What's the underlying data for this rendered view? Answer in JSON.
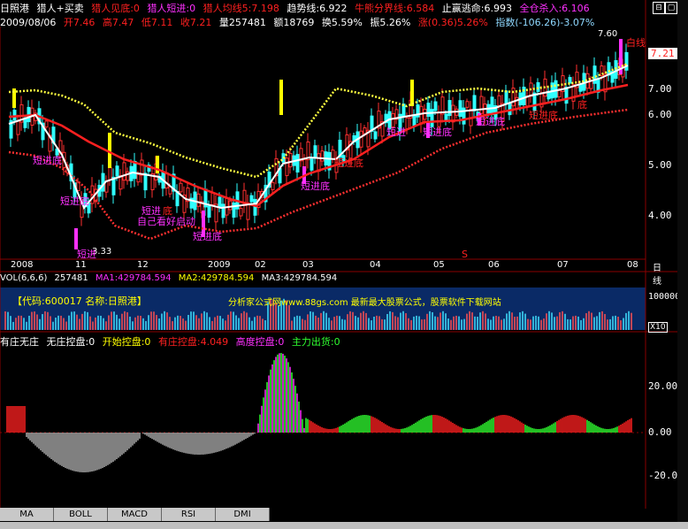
{
  "header": {
    "stock_name": "日照港",
    "indicator_name": "猎人+买卖",
    "hunter_bottom": "猎人见底:0",
    "hunter_short": "猎人短进:0",
    "hunter_avg": "猎人均线5:7.198",
    "trend_line": "趋势线:6.922",
    "bull_bear": "牛熊分界线:6.584",
    "take_profit": "止赢逃命:6.993",
    "all_in": "全仓杀入:6.106"
  },
  "quote": {
    "date": "2009/08/06",
    "open": "开7.46",
    "high": "高7.47",
    "low": "低7.11",
    "close": "收7.21",
    "volume": "量257481",
    "amount": "额18769",
    "turnover": "换5.59%",
    "amplitude": "振5.26%",
    "change": "涨(0.36)5.26%",
    "index": "指数(-106.26)-3.07%"
  },
  "price_axis": [
    "7.00",
    "6.00",
    "5.00",
    "4.00"
  ],
  "price_current": "7.21",
  "price_high_label": "7.60",
  "price_low_label": "3.33",
  "chart_labels": {
    "white_line": "白线",
    "short_entry": "短进",
    "bottom": "底",
    "short_entry_bottom": "短进底",
    "self_look": "自己看好启动",
    "s_mark": "S"
  },
  "time_axis": [
    "2008",
    "11",
    "12",
    "2009",
    "02",
    "03",
    "04",
    "05",
    "06",
    "07",
    "08"
  ],
  "period": "日线",
  "volume_panel": {
    "title": "VOL(6,6,6)",
    "vol": "257481",
    "ma1": "MA1:429784.594",
    "ma2": "MA2:429784.594",
    "ma3": "MA3:429784.594",
    "code_info": "【代码:600017 名称:日照港】",
    "ad": "分析家公式网www.88gs.com 最新最大股票公式，股票软件下载网站",
    "axis_label": "100000",
    "axis_unit": "X10"
  },
  "ctrl_panel": {
    "title": "有庄无庄",
    "no_control": "无庄控盘:0",
    "start_control": "开始控盘:0",
    "has_control": "有庄控盘:4.049",
    "high_control": "高度控盘:0",
    "main_out": "主力出货:0",
    "axis": [
      "20.00",
      "0.00",
      "-20.00"
    ]
  },
  "tabs": [
    "MA",
    "BOLL",
    "MACD",
    "RSI",
    "DMI"
  ],
  "colors": {
    "red": "#ff2020",
    "yellow": "#ffff00",
    "magenta": "#ff30ff",
    "green": "#30ff30",
    "white": "#ffffff",
    "blue_bg": "#0a2a66",
    "axis": "#8a0000"
  }
}
